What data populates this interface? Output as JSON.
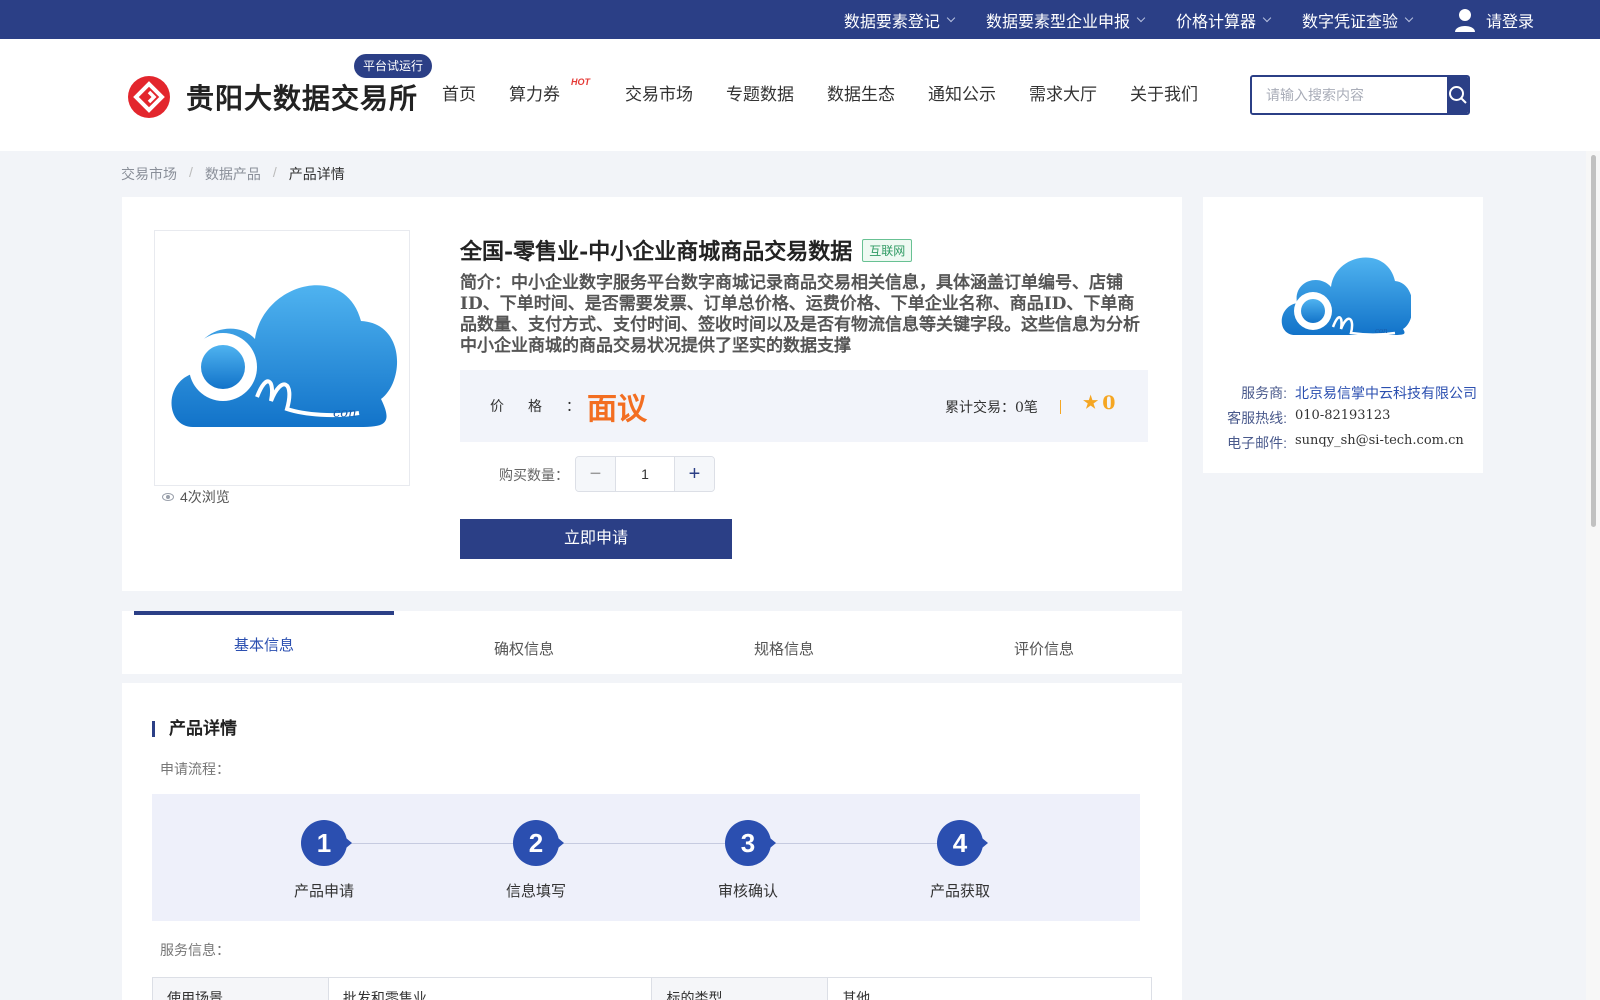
{
  "topbar": {
    "menu": [
      "数据要素登记",
      "数据要素型企业申报",
      "价格计算器",
      "数字凭证查验"
    ],
    "login_label": "请登录"
  },
  "header": {
    "site_name": "贵阳大数据交易所",
    "trial_badge": "平台试运行",
    "nav": [
      "首页",
      "算力券",
      "交易市场",
      "专题数据",
      "数据生态",
      "通知公示",
      "需求大厅",
      "关于我们"
    ],
    "hot_label": "HOT",
    "search_placeholder": "请输入搜索内容"
  },
  "breadcrumb": [
    "交易市场",
    "数据产品",
    "产品详情"
  ],
  "product": {
    "title": "全国-零售业-中小企业商城商品交易数据",
    "tag": "互联网",
    "intro": "简介：中小企业数字服务平台数字商城记录商品交易相关信息，具体涵盖订单编号、店铺ID、下单时间、是否需要发票、订单总价格、运费价格、下单企业名称、商品ID、下单商品数量、支付方式、支付时间、签收时间以及是否有物流信息等关键字段。这些信息为分析中小企业商城的商品交易状况提供了坚实的数据支撑",
    "price_label": "价格：",
    "price_value": "面议",
    "trades_label": "累计交易：",
    "trades_value": "0笔",
    "rating": "0",
    "views": "4次浏览",
    "quantity_label": "购买数量：",
    "quantity": "1",
    "apply_label": "立即申请",
    "logo_text": "con"
  },
  "vendor": {
    "service_label": "服务商:",
    "service_value": "北京易信掌中云科技有限公司",
    "hotline_label": "客服热线:",
    "hotline_value": "010-82193123",
    "email_label": "电子邮件:",
    "email_value": "sunqy_sh@si-tech.com.cn"
  },
  "tabs": [
    "基本信息",
    "确权信息",
    "规格信息",
    "评价信息"
  ],
  "details": {
    "section_title": "产品详情",
    "flow_label": "申请流程：",
    "steps": [
      {
        "num": "1",
        "label": "产品申请"
      },
      {
        "num": "2",
        "label": "信息填写"
      },
      {
        "num": "3",
        "label": "审核确认"
      },
      {
        "num": "4",
        "label": "产品获取"
      }
    ],
    "service_info_label": "服务信息：",
    "table": {
      "k1": "使用场景",
      "v1": "批发和零售业",
      "k2": "标的类型",
      "v2": "其他"
    }
  },
  "colors": {
    "brand": "#2b3f86",
    "accent": "#2b4fb0",
    "price": "#f36e21",
    "star": "#f5a623"
  }
}
